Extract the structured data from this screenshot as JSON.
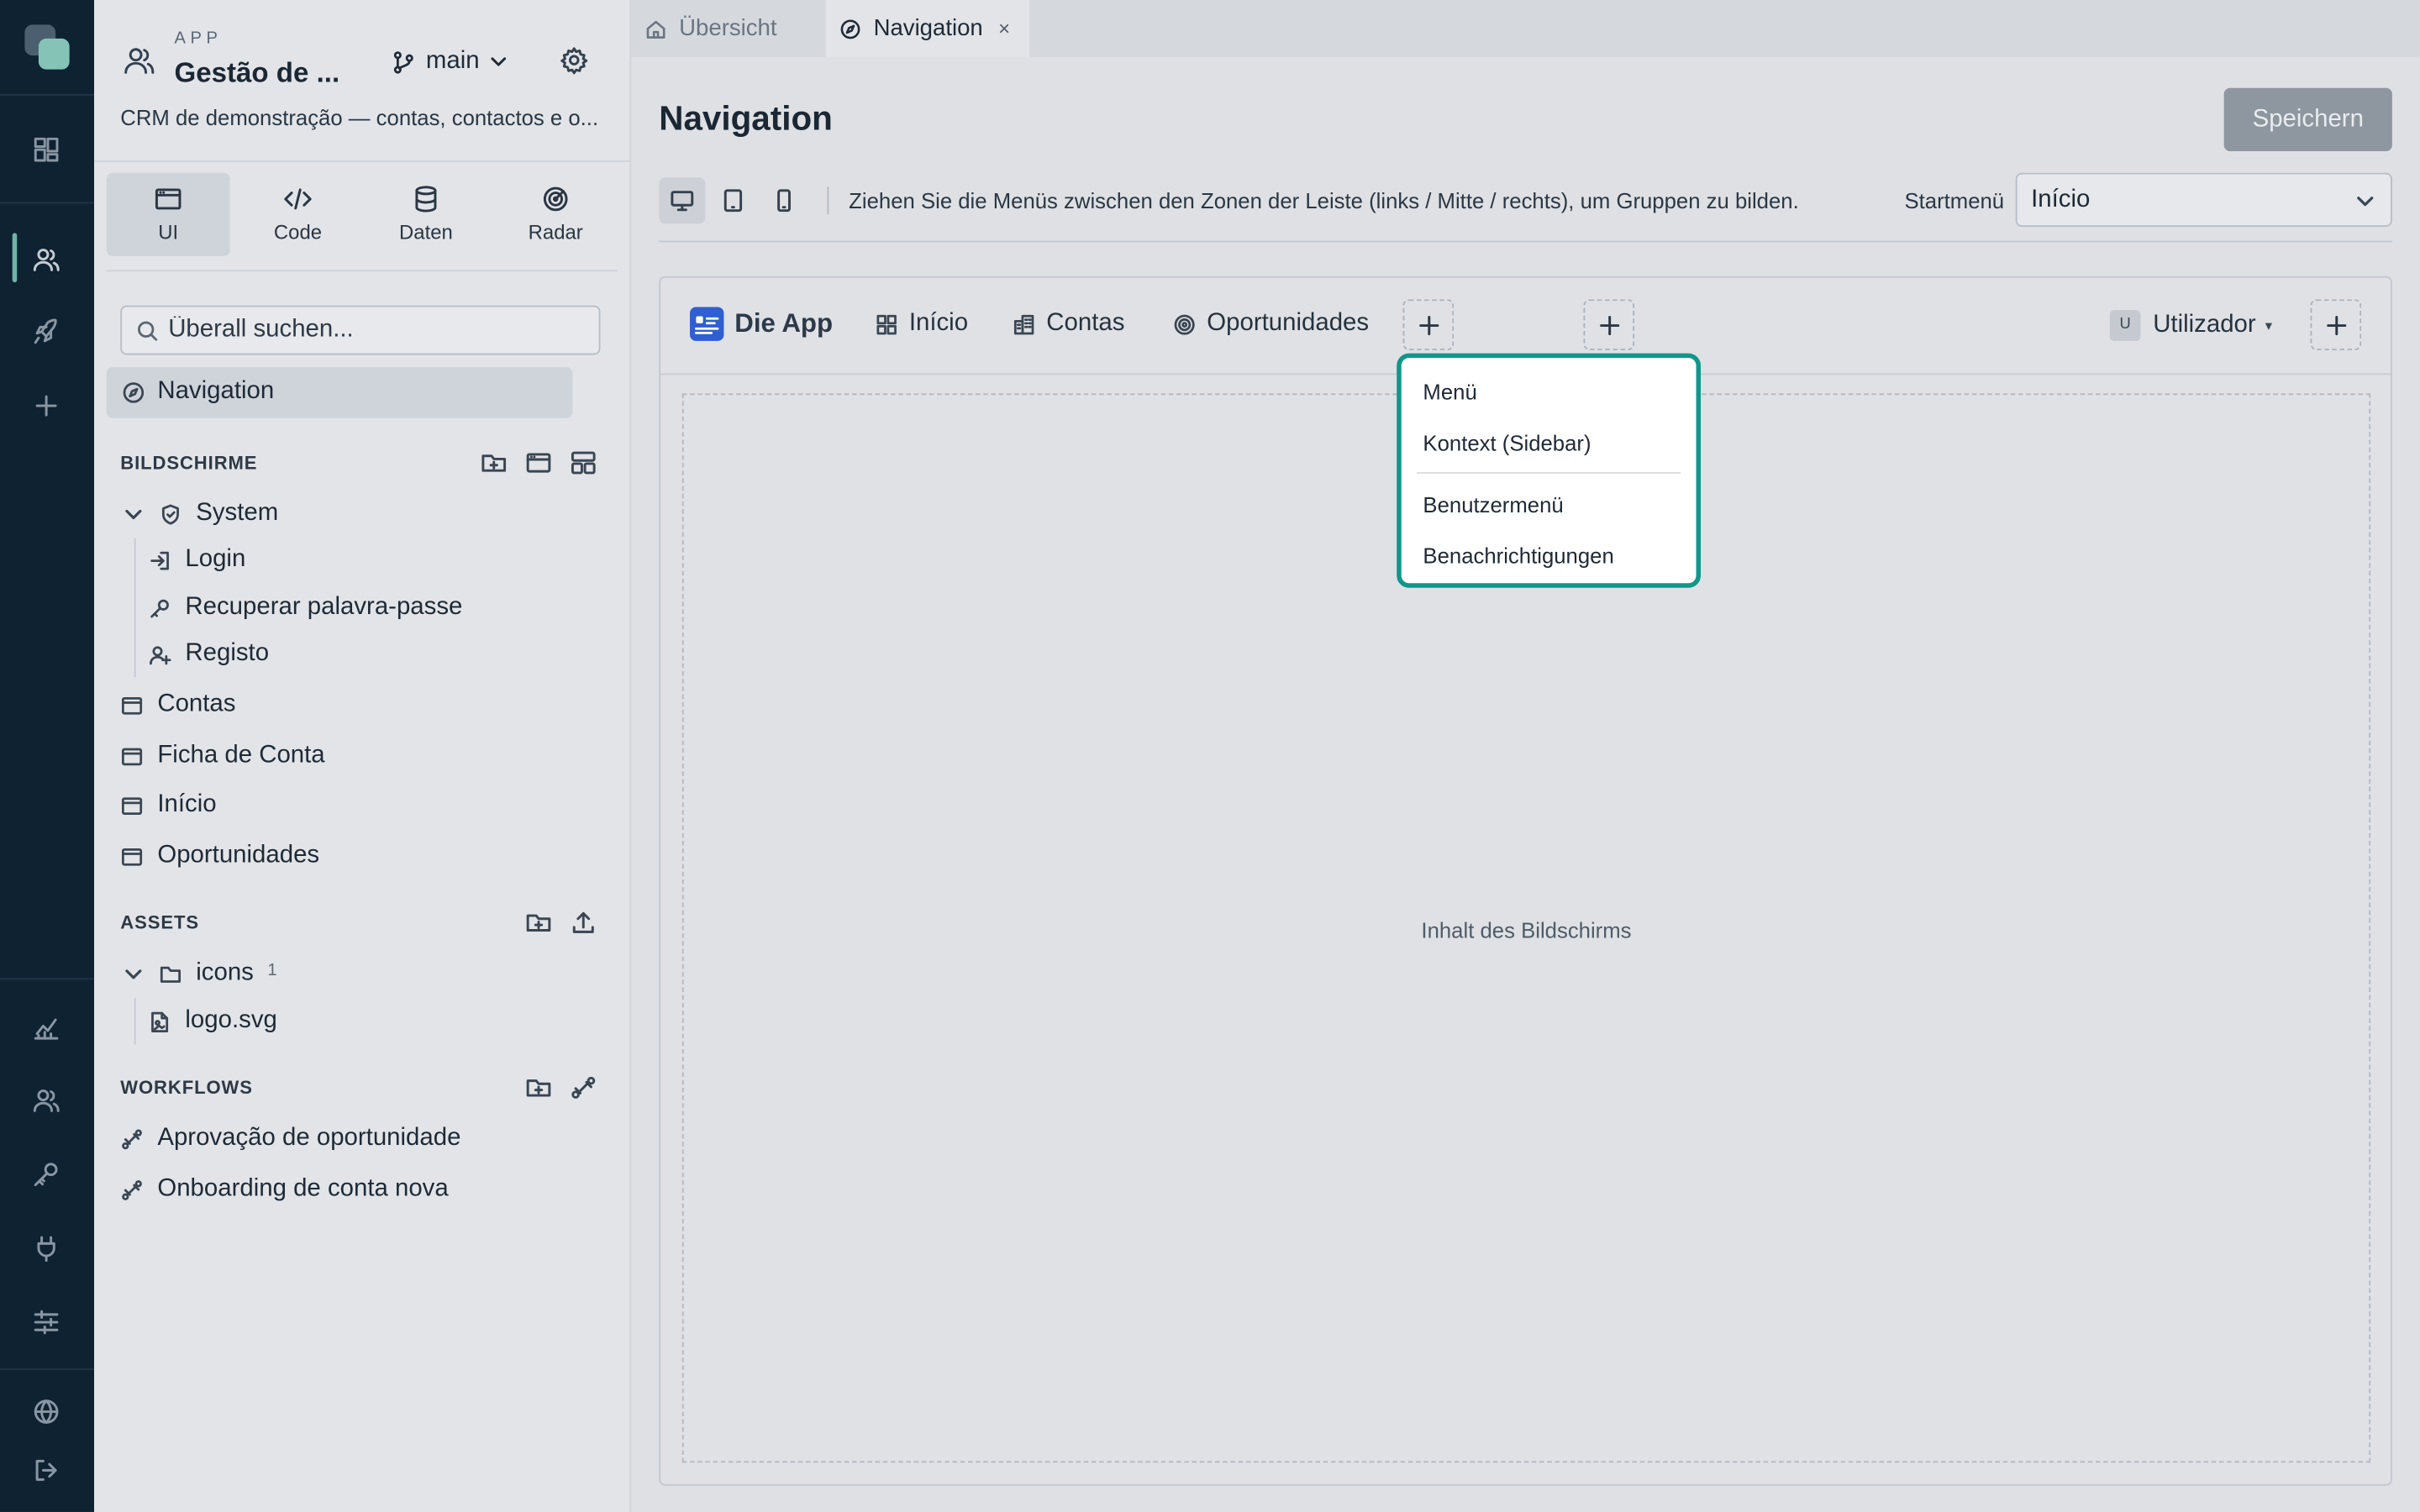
{
  "sidebar": {
    "app_kicker": "APP",
    "app_title": "Gestão de ...",
    "branch": "main",
    "description": "CRM de demonstração — contas, contactos e o...",
    "modes": [
      "UI",
      "Code",
      "Daten",
      "Radar"
    ],
    "search_placeholder": "Überall suchen...",
    "selected_item": "Navigation",
    "screens_title": "BILDSCHIRME",
    "screens": {
      "system_group": "System",
      "login": "Login",
      "recover": "Recuperar palavra-passe",
      "register": "Registo",
      "contas": "Contas",
      "ficha": "Ficha de Conta",
      "inicio": "Início",
      "oportunidades": "Oportunidades"
    },
    "assets_title": "ASSETS",
    "assets": {
      "folder": "icons",
      "folder_count": "1",
      "file": "logo.svg"
    },
    "workflows_title": "WORKFLOWS",
    "workflows": [
      "Aprovação de oportunidade",
      "Onboarding de conta nova"
    ]
  },
  "tabs": {
    "overview": "Übersicht",
    "navigation": "Navigation",
    "close_glyph": "×"
  },
  "main": {
    "title": "Navigation",
    "save_label": "Speichern",
    "hint": "Ziehen Sie die Menüs zwischen den Zonen der Leiste (links / Mitte / rechts), um Gruppen zu bilden.",
    "start_menu_label": "Startmenü",
    "start_menu_value": "Início",
    "navbar": {
      "brand": "Die App",
      "items": [
        "Início",
        "Contas",
        "Oportunidades"
      ],
      "user_initial": "U",
      "user_label": "Utilizador",
      "user_caret": "▾"
    },
    "content_placeholder": "Inhalt des Bildschirms",
    "dropdown": [
      "Menü",
      "Kontext (Sidebar)",
      "Benutzermenü",
      "Benachrichtigungen"
    ]
  },
  "colors": {
    "rail_bg": "#0f2232",
    "accent": "#12968a",
    "brand_icon": "#2f5fd0",
    "save_disabled": "#8e969f"
  }
}
